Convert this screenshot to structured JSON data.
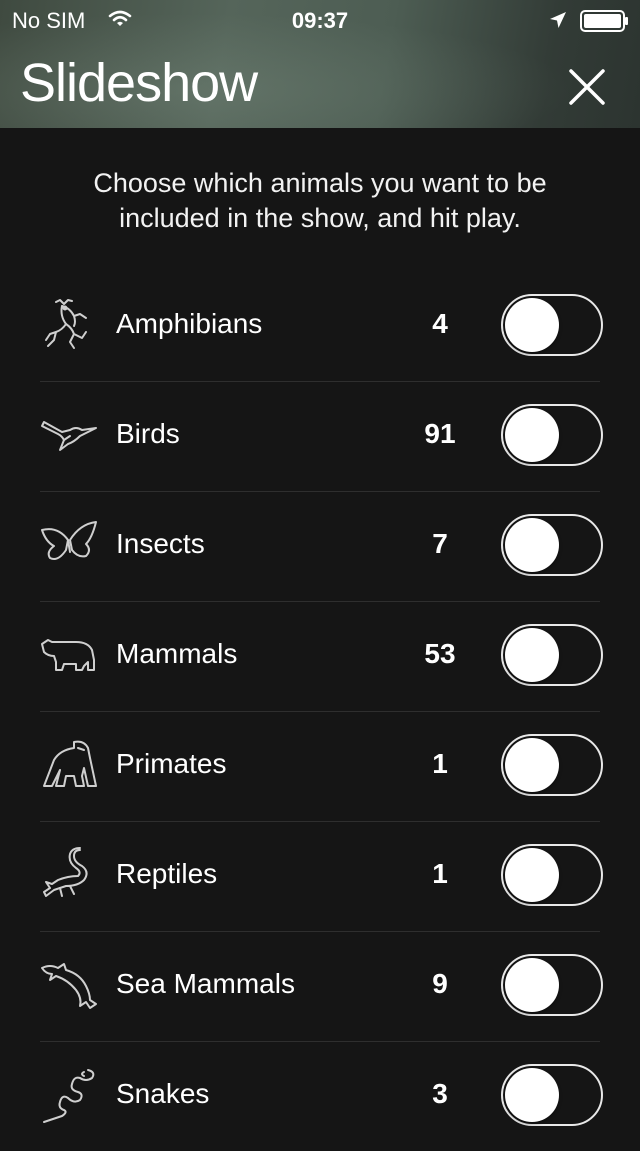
{
  "status_bar": {
    "carrier": "No SIM",
    "time": "09:37"
  },
  "header": {
    "title": "Slideshow",
    "close_icon": "close-icon"
  },
  "intro_text": "Choose which animals you want to be included in the show, and hit play.",
  "categories": [
    {
      "label": "Amphibians",
      "count": "4",
      "icon": "frog-icon",
      "enabled": false
    },
    {
      "label": "Birds",
      "count": "91",
      "icon": "hummingbird-icon",
      "enabled": false
    },
    {
      "label": "Insects",
      "count": "7",
      "icon": "butterfly-icon",
      "enabled": false
    },
    {
      "label": "Mammals",
      "count": "53",
      "icon": "bear-icon",
      "enabled": false
    },
    {
      "label": "Primates",
      "count": "1",
      "icon": "gorilla-icon",
      "enabled": false
    },
    {
      "label": "Reptiles",
      "count": "1",
      "icon": "lizard-icon",
      "enabled": false
    },
    {
      "label": "Sea Mammals",
      "count": "9",
      "icon": "dolphin-icon",
      "enabled": false
    },
    {
      "label": "Snakes",
      "count": "3",
      "icon": "snake-icon",
      "enabled": false
    }
  ],
  "colors": {
    "background": "#151515",
    "divider": "#2e2e2e",
    "toggle_border": "#e8e8e8",
    "icon_stroke": "#cfcfcf"
  }
}
